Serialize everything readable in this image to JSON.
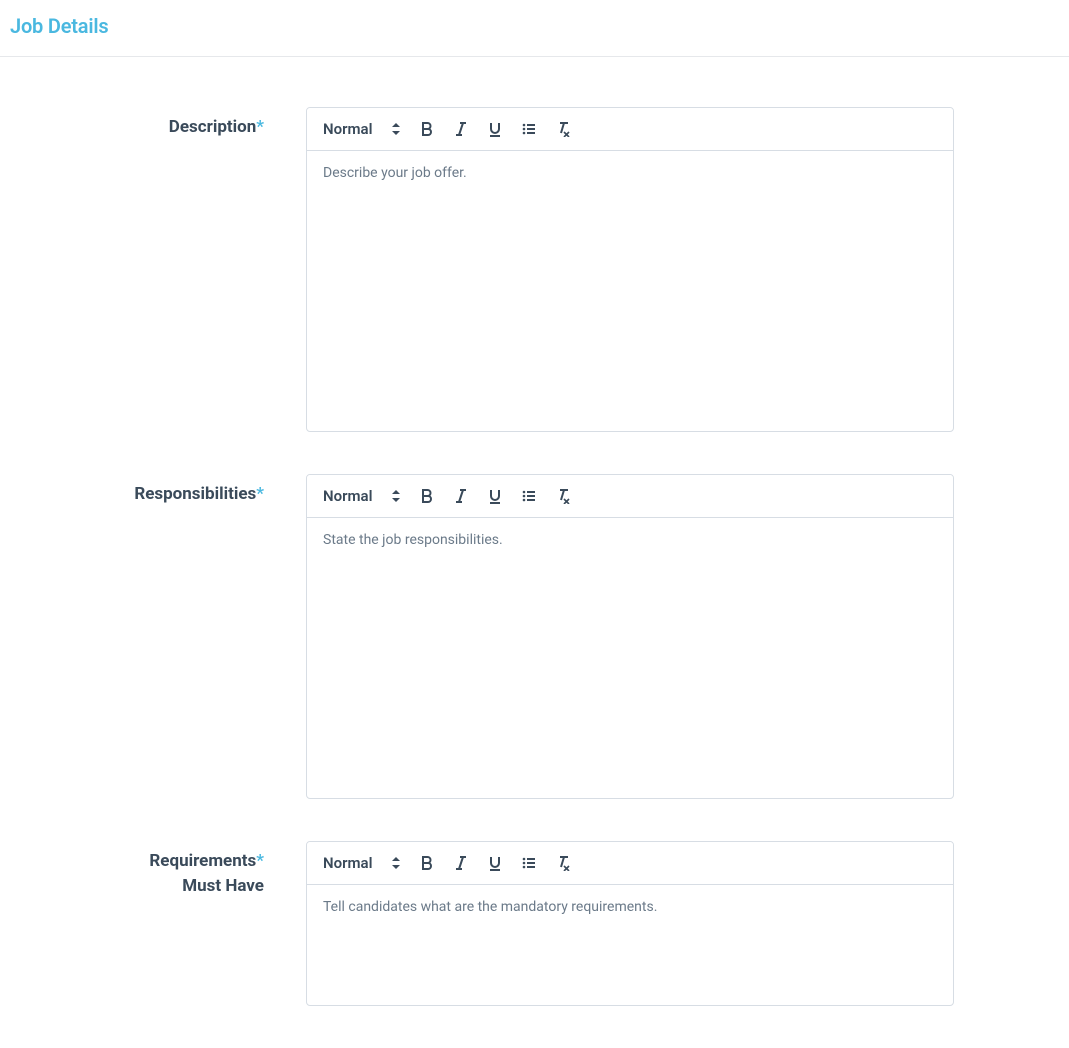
{
  "section": {
    "title": "Job Details"
  },
  "fields": {
    "description": {
      "label": "Description",
      "required_mark": "*",
      "placeholder": "Describe your job offer."
    },
    "responsibilities": {
      "label": "Responsibilities",
      "required_mark": "*",
      "placeholder": "State the job responsibilities."
    },
    "requirements": {
      "label": "Requirements",
      "sublabel": "Must Have",
      "required_mark": "*",
      "placeholder": "Tell candidates what are the mandatory requirements."
    }
  },
  "toolbar": {
    "format_label": "Normal"
  }
}
